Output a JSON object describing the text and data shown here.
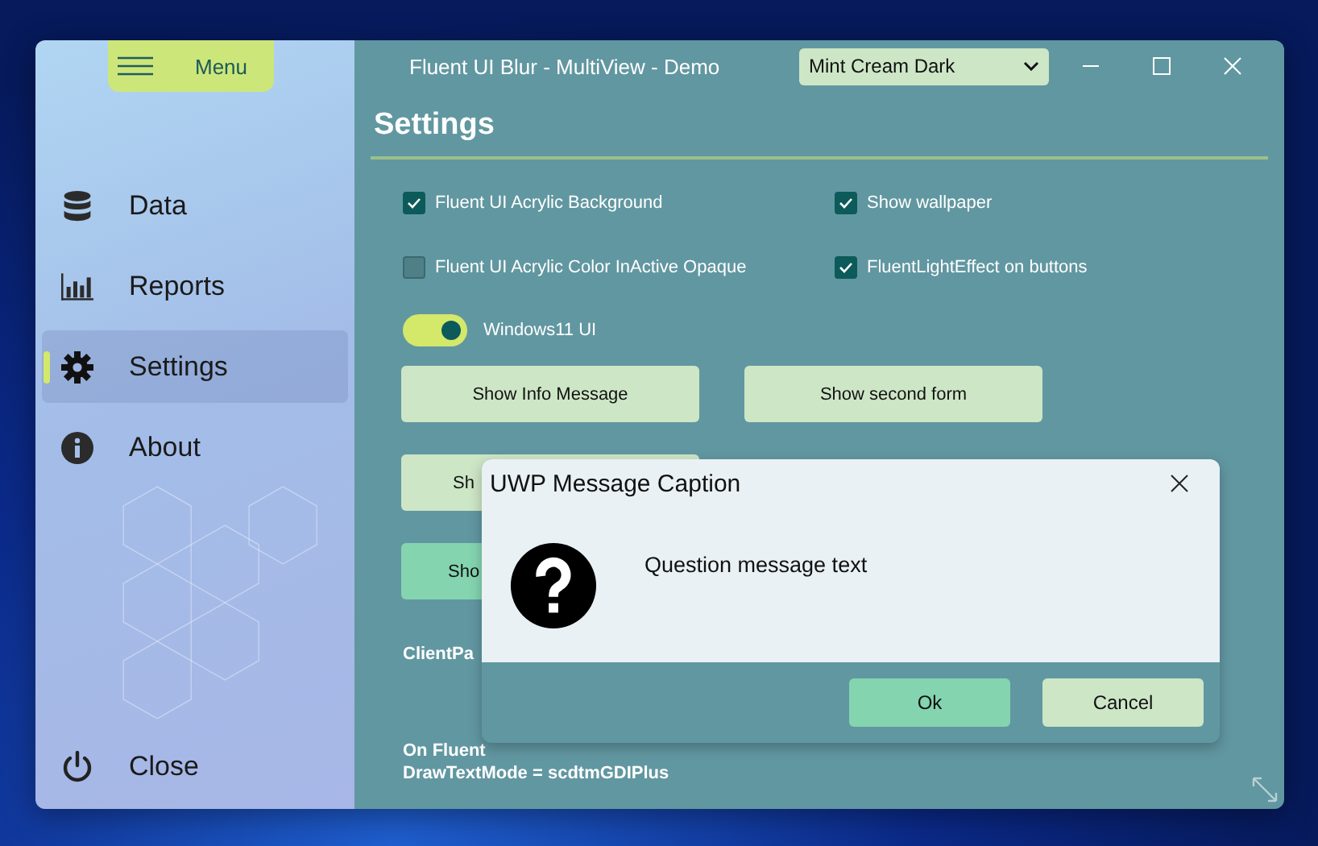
{
  "window": {
    "title": "Fluent UI Blur - MultiView - Demo",
    "theme_dropdown": "Mint Cream Dark"
  },
  "menu_button": {
    "label": "Menu"
  },
  "sidebar": {
    "items": [
      {
        "label": "Data",
        "selected": false
      },
      {
        "label": "Reports",
        "selected": false
      },
      {
        "label": "Settings",
        "selected": true
      },
      {
        "label": "About",
        "selected": false
      }
    ],
    "close": {
      "label": "Close"
    }
  },
  "settings": {
    "heading": "Settings",
    "checkboxes": [
      {
        "label": "Fluent UI Acrylic Background",
        "checked": true
      },
      {
        "label": "Show wallpaper",
        "checked": true
      },
      {
        "label": "Fluent UI Acrylic Color InActive Opaque",
        "checked": false
      },
      {
        "label": "FluentLightEffect on buttons",
        "checked": true
      }
    ],
    "toggle": {
      "label": "Windows11 UI",
      "on": true
    },
    "buttons": [
      {
        "label": "Show Info Message",
        "kind": "light"
      },
      {
        "label": "Show second form",
        "kind": "light"
      }
    ],
    "covered_buttons": [
      {
        "label": "Sh",
        "kind": "light"
      },
      {
        "label": "Sho",
        "kind": "green"
      }
    ],
    "notes": [
      "ClientPa",
      "On Fluent",
      "DrawTextMode = scdtmGDIPlus"
    ]
  },
  "dialog": {
    "caption": "UWP Message Caption",
    "message": "Question message text",
    "buttons": [
      {
        "label": "Ok",
        "kind": "green"
      },
      {
        "label": "Cancel",
        "kind": "light"
      }
    ]
  }
}
